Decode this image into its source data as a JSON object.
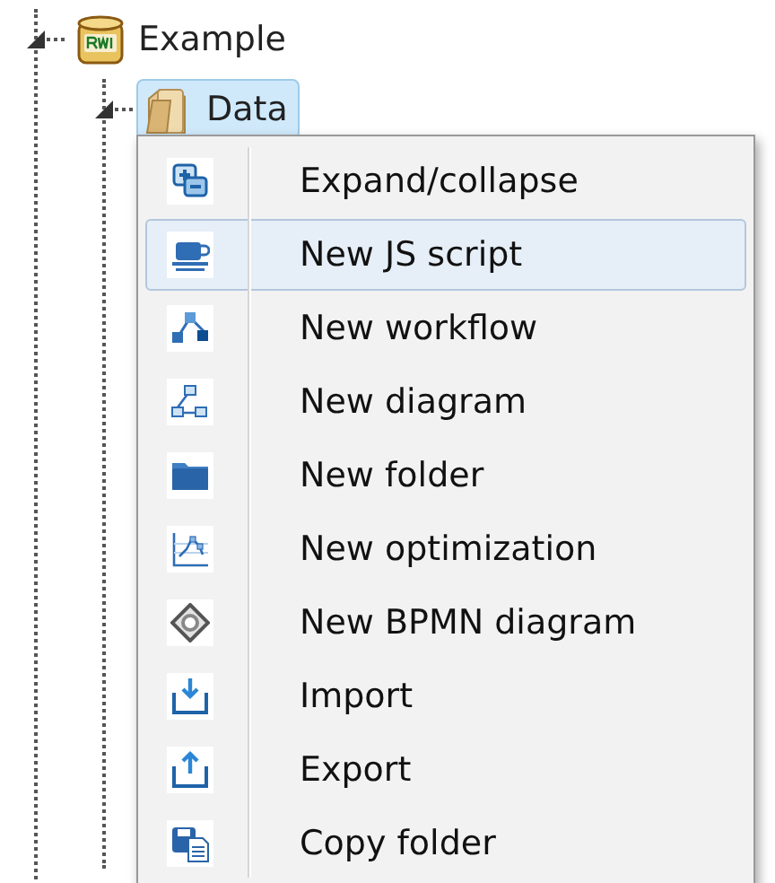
{
  "tree": [
    {
      "label": "Example",
      "kind": "project",
      "expanded": true,
      "selected": false,
      "children": [
        {
          "label": "Data",
          "kind": "folder",
          "expanded": true,
          "selected": true
        }
      ]
    }
  ],
  "context_menu": {
    "items": [
      {
        "label": "Expand/collapse",
        "kind": "expand",
        "selected": false
      },
      {
        "label": "New JS script",
        "kind": "script",
        "selected": true
      },
      {
        "label": "New workflow",
        "kind": "workflow",
        "selected": false
      },
      {
        "label": "New diagram",
        "kind": "diagram",
        "selected": false
      },
      {
        "label": "New folder",
        "kind": "folder",
        "selected": false
      },
      {
        "label": "New optimization",
        "kind": "optimization",
        "selected": false
      },
      {
        "label": "New BPMN diagram",
        "kind": "bpmn",
        "selected": false
      },
      {
        "label": "Import",
        "kind": "import",
        "selected": false
      },
      {
        "label": "Export",
        "kind": "export",
        "selected": false
      },
      {
        "label": "Copy folder",
        "kind": "copy",
        "selected": false
      }
    ]
  }
}
